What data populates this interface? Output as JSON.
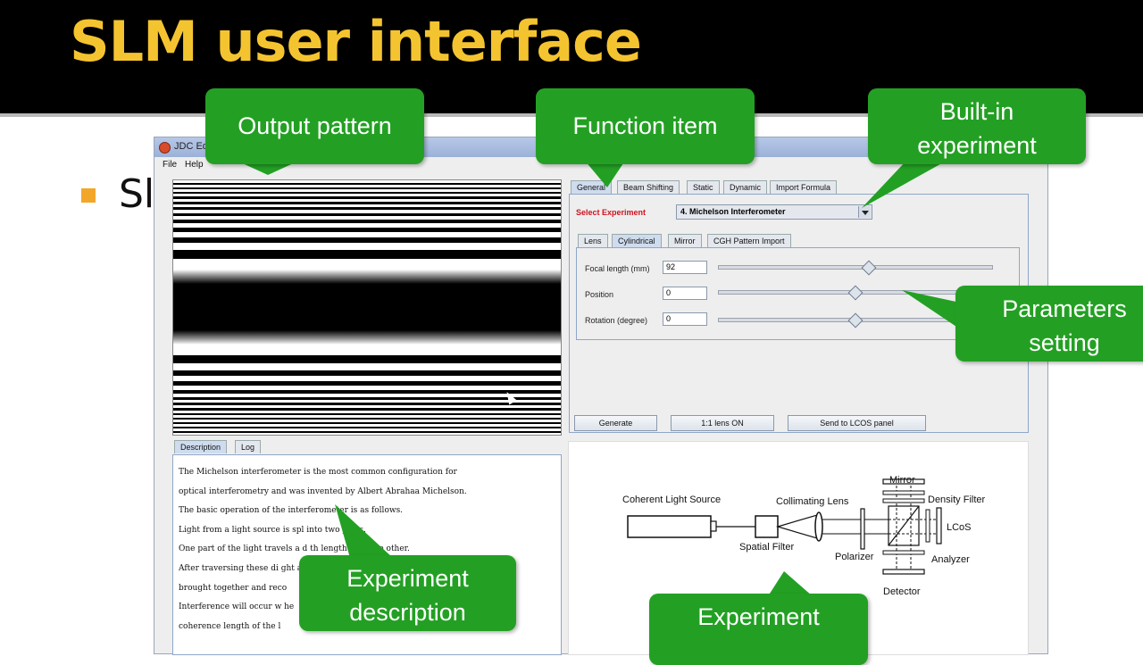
{
  "slide": {
    "title": "SLM user interface",
    "bullet": "Sl"
  },
  "window": {
    "title": "JDC Edu",
    "menu": [
      "File",
      "Help"
    ]
  },
  "tabs": [
    "General",
    "Beam Shifting",
    "Static",
    "Dynamic",
    "Import Formula"
  ],
  "select_experiment": {
    "label": "Select Experiment",
    "value": "4. Michelson Interferometer"
  },
  "sub_tabs": [
    "Lens",
    "Cylindrical",
    "Mirror",
    "CGH Pattern Import"
  ],
  "parameters": [
    {
      "label": "Focal length (mm)",
      "value": "92",
      "slider_level": 0.55
    },
    {
      "label": "Position",
      "value": "0",
      "slider_level": 0.5
    },
    {
      "label": "Rotation (degree)",
      "value": "0",
      "slider_level": 0.5
    }
  ],
  "buttons": {
    "generate": "Generate",
    "lens": "1:1 lens ON",
    "send": "Send to LCOS panel"
  },
  "desc_tabs": [
    "Description",
    "Log"
  ],
  "description_lines": [
    "        The Michelson interferometer is the most common configuration for",
    "optical interferometry and was invented by Albert Abrahaa Michelson.",
    "The basic operation of the interferometer is as follows.",
    "Light from a light source is spl      into two parts.",
    "One part of the light travels a d          th length than the other.",
    "After traversing these di                                          ght are",
    "brought together and reco",
    "Interference will occur w                                          he",
    "coherence length of the l"
  ],
  "diagram": {
    "labels": {
      "source": "Coherent Light Source",
      "lens": "Collimating Lens",
      "filter": "Spatial Filter",
      "polarizer": "Polarizer",
      "mirror": "Mirror",
      "density": "Density Filter",
      "lcos": "LCoS",
      "analyzer": "Analyzer",
      "detector": "Detector"
    }
  },
  "callouts": {
    "output_pattern": "Output pattern",
    "function_item": "Function item",
    "builtin_1": "Built-in",
    "builtin_2": "experiment",
    "params_1": "Parameters",
    "params_2": "setting",
    "expdesc_1": "Experiment",
    "expdesc_2": "description",
    "exp_3": "Experiment"
  },
  "colors": {
    "callout_green": "#23a023",
    "title_yellow": "#f4c430",
    "select_red": "#d0121e"
  }
}
